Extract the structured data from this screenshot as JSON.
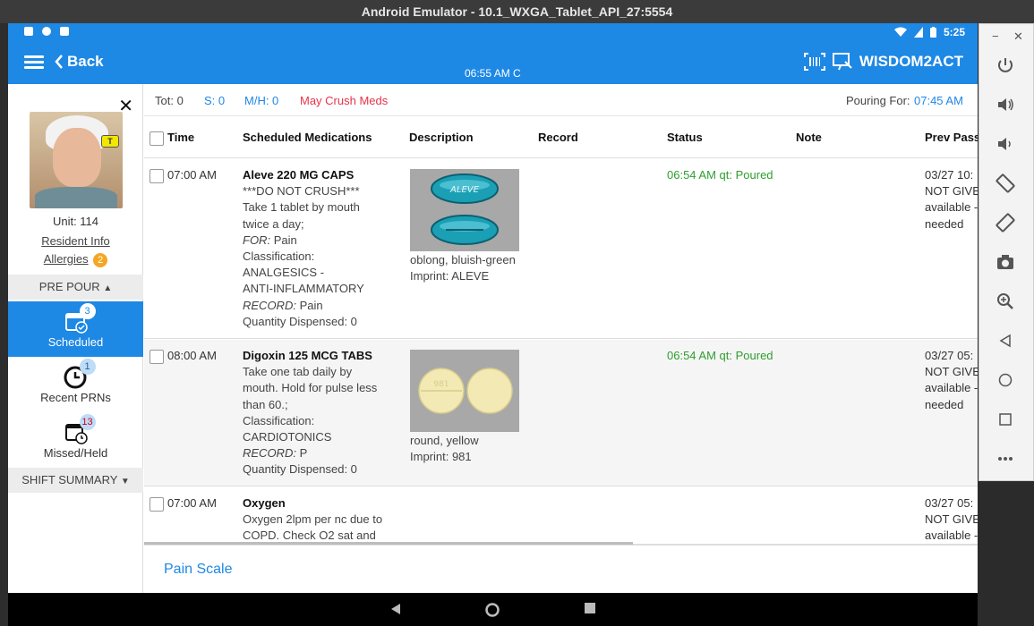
{
  "window": {
    "title": "Android Emulator - 10.1_WXGA_Tablet_API_27:5554"
  },
  "statusbar": {
    "time": "5:25"
  },
  "appbar": {
    "back_label": "Back",
    "clock": "06:55 AM C",
    "brand": "WISDOM2ACT"
  },
  "resident": {
    "badge": "T",
    "unit": "Unit: 114",
    "info_link": "Resident Info",
    "allergies_link": "Allergies",
    "allergies_count": "2"
  },
  "sidebar": {
    "pre_pour": "PRE POUR",
    "shift_summary": "SHIFT SUMMARY",
    "items": [
      {
        "label": "Scheduled",
        "count": "3"
      },
      {
        "label": "Recent PRNs",
        "count": "1"
      },
      {
        "label": "Missed/Held",
        "count": "13"
      }
    ]
  },
  "summary": {
    "tot": "Tot: 0",
    "s": "S: 0",
    "mh": "M/H: 0",
    "crush": "May Crush Meds",
    "pouring_label": "Pouring For:",
    "pouring_time": "07:45 AM"
  },
  "columns": [
    "Time",
    "Scheduled Medications",
    "Description",
    "Record",
    "Status",
    "Note",
    "Prev Pass"
  ],
  "rows": [
    {
      "time": "07:00 AM",
      "med_name": "Aleve 220 MG CAPS",
      "med_lines": [
        "***DO NOT CRUSH***",
        "Take 1 tablet by mouth",
        "twice a day;"
      ],
      "for_label": "FOR:",
      "for_value": "Pain",
      "class_label": "Classification:",
      "class_lines": [
        "ANALGESICS -",
        "ANTI-INFLAMMATORY"
      ],
      "record_label": "RECORD:",
      "record_value": "Pain",
      "qty": "Quantity Dispensed: 0",
      "desc_shape": "oblong, bluish-green",
      "desc_imprint": "Imprint: ALEVE",
      "pill_imprint": "ALEVE",
      "status": "06:54 AM qt: Poured",
      "prev": [
        "03/27 10:",
        "NOT GIVE",
        "available -",
        "needed"
      ]
    },
    {
      "time": "08:00 AM",
      "med_name": "Digoxin 125 MCG TABS",
      "med_lines": [
        "Take one tab daily by",
        "mouth.  Hold for pulse less",
        "than 60.;"
      ],
      "class_label": "Classification:",
      "class_lines": [
        "CARDIOTONICS"
      ],
      "record_label": "RECORD:",
      "record_value": "P",
      "qty": "Quantity Dispensed: 0",
      "desc_shape": "round, yellow",
      "desc_imprint": "Imprint: 981",
      "pill_imprint": "981",
      "status": "06:54 AM qt: Poured",
      "prev": [
        "03/27 05:",
        "NOT GIVE",
        "available -",
        "needed"
      ]
    },
    {
      "time": "07:00 AM",
      "med_name": "Oxygen",
      "med_lines": [
        "Oxygen 2lpm per nc due to",
        "COPD. Check O2 sat and"
      ],
      "prev": [
        "03/27 05:",
        "NOT GIVE",
        "available -"
      ]
    }
  ],
  "bottom": {
    "pain_scale": "Pain Scale"
  },
  "colors": {
    "primary": "#1e88e5",
    "status_green": "#2e9e2e",
    "crush_red": "#e8334a"
  }
}
